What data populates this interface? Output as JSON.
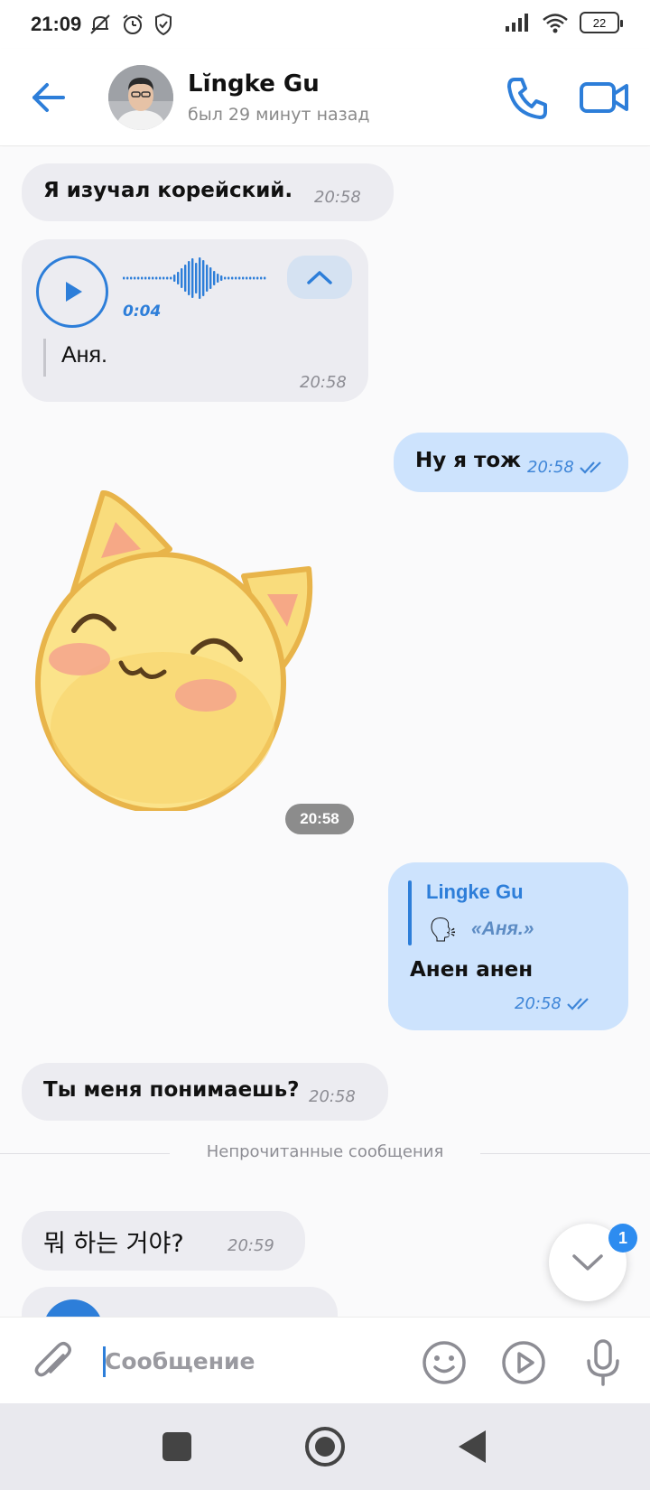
{
  "status_bar": {
    "time": "21:09",
    "battery": "22"
  },
  "header": {
    "contact_name": "Lĭngke Gu",
    "contact_status": "был 29 минут назад",
    "icons": [
      "back-arrow-icon",
      "phone-icon",
      "video-camera-icon"
    ]
  },
  "messages": [
    {
      "type": "text",
      "direction": "in",
      "text": "Я изучал корейский.",
      "time": "20:58"
    },
    {
      "type": "voice",
      "direction": "in",
      "duration": "0:04",
      "transcript": "Аня.",
      "time": "20:58"
    },
    {
      "type": "text",
      "direction": "out",
      "text": "Ну я тож",
      "time": "20:58",
      "read": true
    },
    {
      "type": "sticker",
      "direction": "in",
      "time": "20:58"
    },
    {
      "type": "reply",
      "direction": "out",
      "reply_to_name": "Lingke Gu",
      "reply_quote": "«Аня.»",
      "text": "Анен анен",
      "time": "20:58",
      "read": true
    },
    {
      "type": "text",
      "direction": "in",
      "text": "Ты меня понимаешь?",
      "time": "20:58"
    },
    {
      "type": "text",
      "direction": "in",
      "text": "뭐 하는 거야?",
      "time": "20:59"
    }
  ],
  "unread_divider": "Непрочитанные сообщения",
  "scroll_down": {
    "badge": "1"
  },
  "composer": {
    "placeholder": "Сообщение"
  },
  "colors": {
    "accent": "#2d7ed9",
    "incoming_bubble": "#ececf1",
    "outgoing_bubble": "#cde3fd"
  }
}
